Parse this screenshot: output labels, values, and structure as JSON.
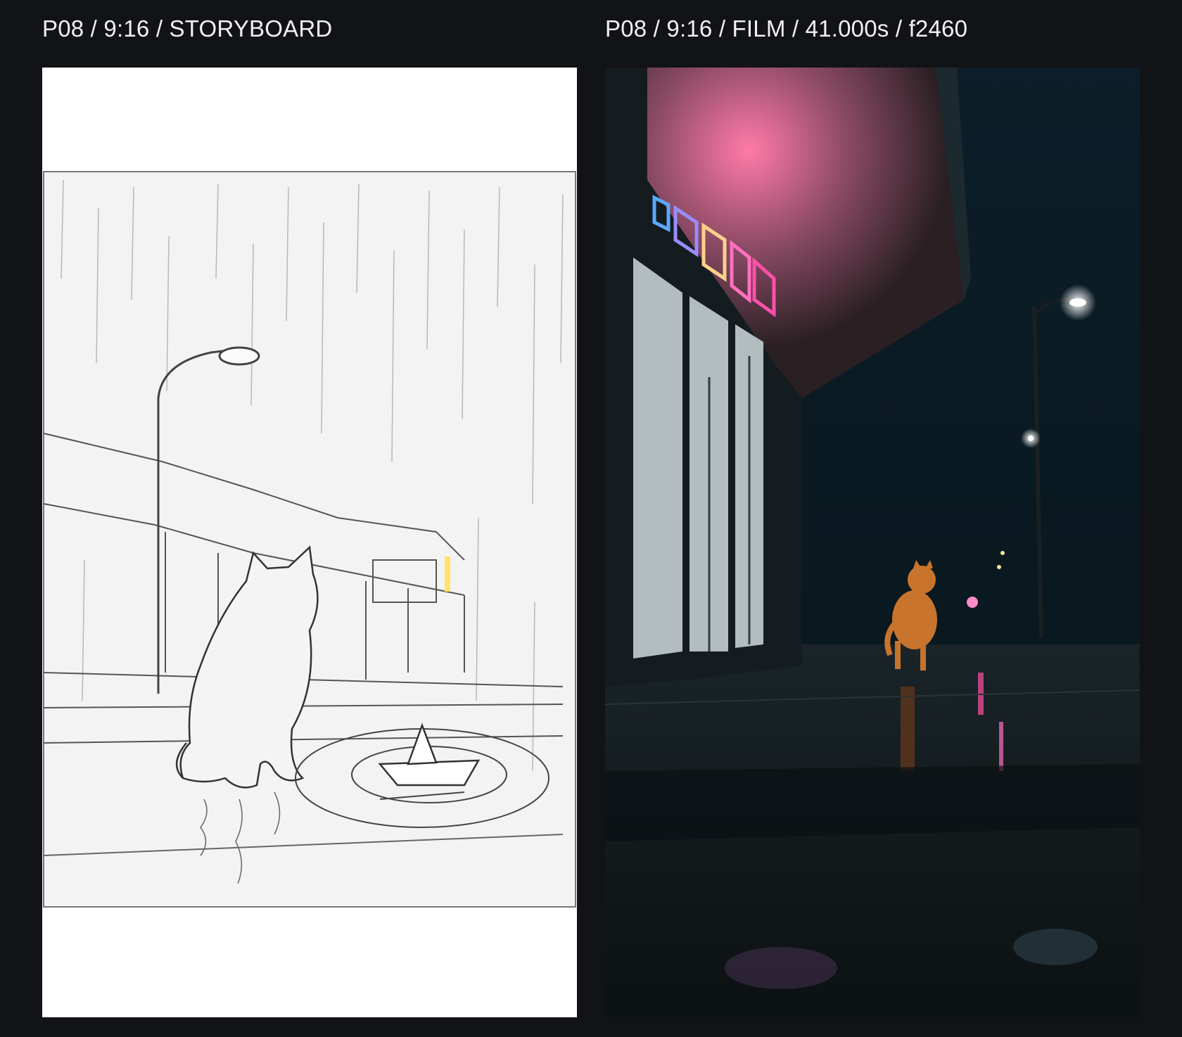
{
  "panels": [
    {
      "caption": "P08 / 9:16 / STORYBOARD",
      "kind": "storyboard-sketch",
      "subject": "cat-in-rain-sketch"
    },
    {
      "caption": "P08 / 9:16 / FILM / 41.000s / f2460",
      "kind": "film-frame",
      "subject": "cat-on-wet-street-night"
    }
  ],
  "colors": {
    "background": "#111317",
    "caption_text": "#f1f1f1",
    "sketch_paper": "#ffffff",
    "sketch_line": "#4a4a4a",
    "film_night": "#0b1418",
    "neon_pink": "#ff4fa8",
    "neon_blue": "#5aa8ff",
    "cat_orange": "#c8742c"
  }
}
